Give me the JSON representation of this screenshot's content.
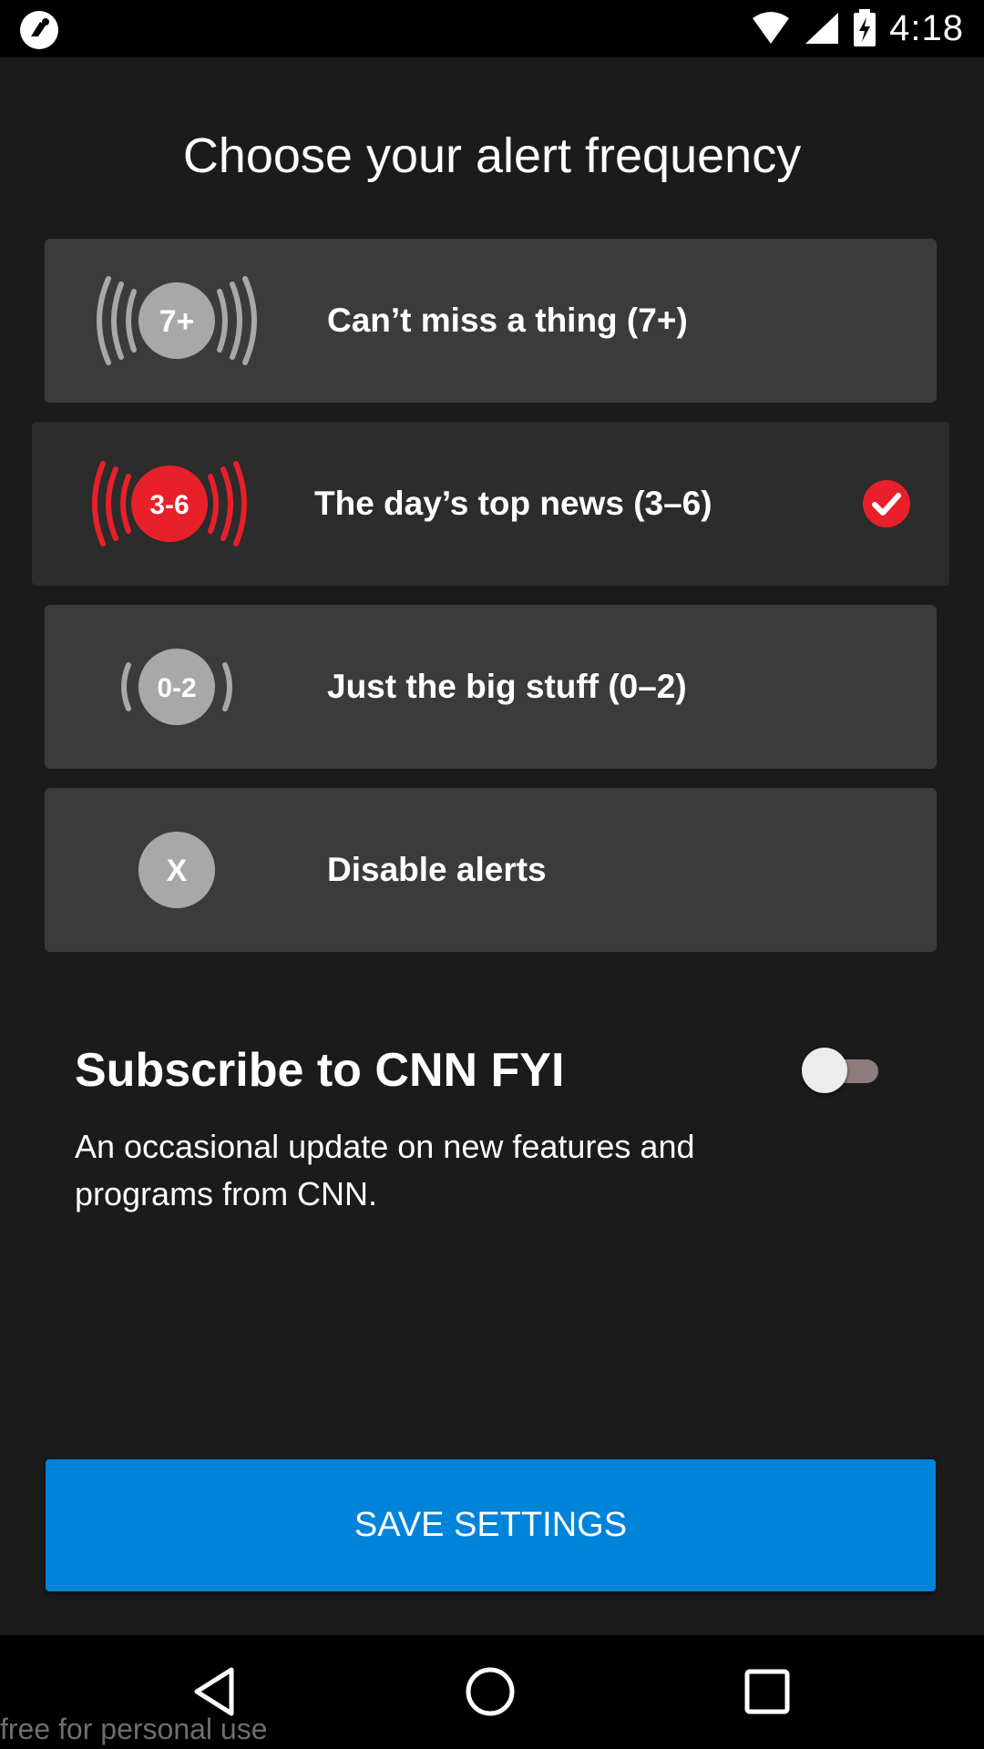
{
  "status_bar": {
    "time": "4:18",
    "icons": [
      "app-logo-icon",
      "wifi-icon",
      "cell-signal-icon",
      "battery-charging-icon"
    ]
  },
  "page": {
    "title": "Choose your alert frequency"
  },
  "options": [
    {
      "badge": "7+",
      "label": "Can’t miss a thing (7+)",
      "selected": false,
      "icon": "broadcast-7plus-icon"
    },
    {
      "badge": "3-6",
      "label": "The day’s top news (3–6)",
      "selected": true,
      "icon": "broadcast-3to6-icon"
    },
    {
      "badge": "0-2",
      "label": "Just the big stuff (0–2)",
      "selected": false,
      "icon": "broadcast-0to2-icon"
    },
    {
      "badge": "X",
      "label": "Disable alerts",
      "selected": false,
      "icon": "disable-x-icon"
    }
  ],
  "subscribe": {
    "title": "Subscribe to CNN FYI",
    "description": "An occasional update on new features and programs from CNN.",
    "enabled": false
  },
  "save_button": {
    "label": "SAVE SETTINGS"
  },
  "nav_bar": {
    "icons": [
      "back-icon",
      "home-icon",
      "recents-icon"
    ]
  },
  "watermark": "free for personal use",
  "colors": {
    "background": "#1b1b1b",
    "card": "#3b3b3b",
    "card_selected": "#2c2c2c",
    "accent_red": "#e8202a",
    "badge_gray": "#a8a8a8",
    "button_blue": "#0084d9"
  }
}
